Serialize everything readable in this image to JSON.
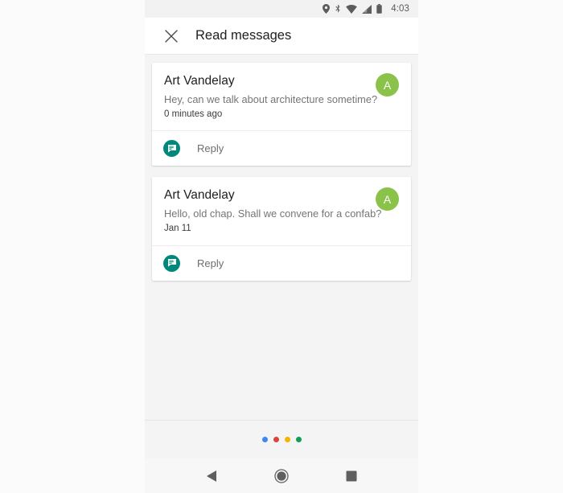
{
  "status_bar": {
    "time": "4:03",
    "icons": [
      "location-icon",
      "bluetooth-icon",
      "wifi-icon",
      "signal-icon",
      "battery-icon"
    ],
    "background": "#f2f2f2"
  },
  "app_bar": {
    "close_icon": "close-icon",
    "title": "Read messages"
  },
  "messages": [
    {
      "sender": "Art Vandelay",
      "preview": "Hey, can we talk about architecture sometime?",
      "timestamp": "0 minutes ago",
      "avatar_letter": "A",
      "avatar_color": "#8BC34A",
      "action_label": "Reply",
      "action_icon": "message-reply-icon",
      "action_icon_color": "#00897B"
    },
    {
      "sender": "Art Vandelay",
      "preview": "Hello, old chap. Shall we convene for a confab?",
      "timestamp": "Jan 11",
      "avatar_letter": "A",
      "avatar_color": "#8BC34A",
      "action_label": "Reply",
      "action_icon": "message-reply-icon",
      "action_icon_color": "#00897B"
    }
  ],
  "page_dots": {
    "colors": [
      "#4285F4",
      "#DB4437",
      "#F4B400",
      "#0F9D58"
    ],
    "active_index": 0
  },
  "nav_bar": {
    "back_icon": "back-triangle-icon",
    "home_icon": "home-circle-icon",
    "recents_icon": "recents-square-icon"
  }
}
